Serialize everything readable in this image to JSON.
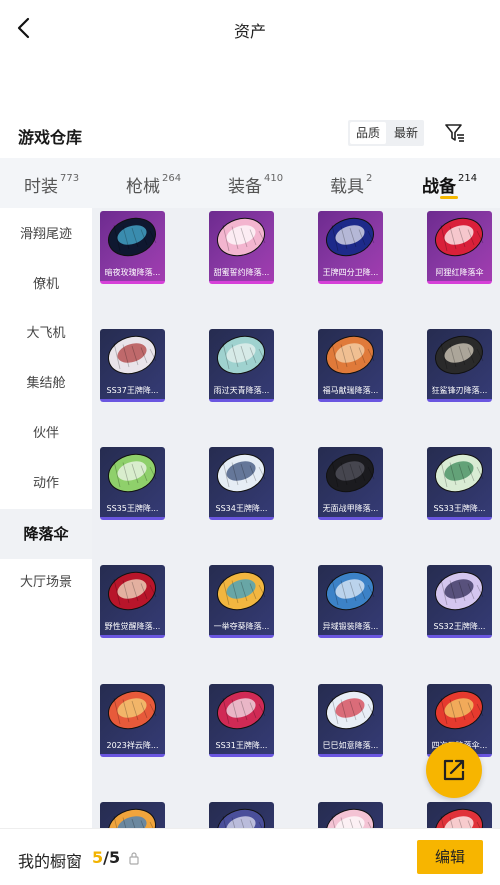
{
  "header": {
    "title": "资产"
  },
  "section": {
    "title": "游戏仓库",
    "sort_options": [
      "品质",
      "最新"
    ]
  },
  "tabs": [
    {
      "label": "时装",
      "count": "773"
    },
    {
      "label": "枪械",
      "count": "264"
    },
    {
      "label": "装备",
      "count": "410"
    },
    {
      "label": "载具",
      "count": "2"
    },
    {
      "label": "战备",
      "count": "214"
    }
  ],
  "sidebar": {
    "items": [
      "滑翔尾迹",
      "僚机",
      "大飞机",
      "集结舱",
      "伙伴",
      "动作",
      "降落伞",
      "大厅场景"
    ]
  },
  "items": [
    {
      "label": "暗夜玫瑰降落...",
      "tier": "purple",
      "colors": [
        "#0f1830",
        "#4ab3d8"
      ]
    },
    {
      "label": "甜蜜誓约降落...",
      "tier": "purple",
      "colors": [
        "#f3b5cf",
        "#ffffff"
      ]
    },
    {
      "label": "王牌四分卫降...",
      "tier": "purple",
      "colors": [
        "#1d2a8a",
        "#e8e8f0"
      ]
    },
    {
      "label": "阿狸红降落伞",
      "tier": "purple",
      "colors": [
        "#d9203a",
        "#ffffff"
      ]
    },
    {
      "label": "SS37王牌降...",
      "tier": "navy",
      "colors": [
        "#e9e4ea",
        "#b04040"
      ]
    },
    {
      "label": "雨过天青降落...",
      "tier": "navy",
      "colors": [
        "#9fd2cf",
        "#e8f2ef"
      ]
    },
    {
      "label": "福马献瑞降落...",
      "tier": "navy",
      "colors": [
        "#e07a3a",
        "#f6d7b0"
      ]
    },
    {
      "label": "狂鲨锋刃降落...",
      "tier": "navy",
      "colors": [
        "#2a2a2a",
        "#d8d0c0"
      ]
    },
    {
      "label": "SS35王牌降...",
      "tier": "navy",
      "colors": [
        "#8fd06b",
        "#f2f7ee"
      ]
    },
    {
      "label": "SS34王牌降...",
      "tier": "navy",
      "colors": [
        "#e6edf5",
        "#3a4f7a"
      ]
    },
    {
      "label": "无面战甲降落...",
      "tier": "navy",
      "colors": [
        "#1b1b1f",
        "#555560"
      ]
    },
    {
      "label": "SS33王牌降...",
      "tier": "navy",
      "colors": [
        "#d9ecd4",
        "#3b8a5a"
      ]
    },
    {
      "label": "野性觉醒降落...",
      "tier": "navy",
      "colors": [
        "#b8152a",
        "#f1e4c8"
      ]
    },
    {
      "label": "一举夺葵降落...",
      "tier": "navy",
      "colors": [
        "#f2b640",
        "#3aa0c8"
      ]
    },
    {
      "label": "异域锻装降落...",
      "tier": "navy",
      "colors": [
        "#3c82c7",
        "#e6eef8"
      ]
    },
    {
      "label": "SS32王牌降...",
      "tier": "navy",
      "colors": [
        "#d4c6ef",
        "#2f2a55"
      ]
    },
    {
      "label": "2023祥云降...",
      "tier": "navy",
      "colors": [
        "#e75a3a",
        "#f6d47a"
      ]
    },
    {
      "label": "SS31王牌降...",
      "tier": "navy",
      "colors": [
        "#d02a55",
        "#f2e6ee"
      ]
    },
    {
      "label": "巳巳如意降落...",
      "tier": "navy",
      "colors": [
        "#e8eef6",
        "#d6404f"
      ]
    },
    {
      "label": "四次元降落伞...",
      "tier": "navy",
      "colors": [
        "#e63a2e",
        "#f4d06a"
      ]
    },
    {
      "label": "",
      "tier": "navy",
      "colors": [
        "#f0a43c",
        "#3f7fc0"
      ]
    },
    {
      "label": "",
      "tier": "navy",
      "colors": [
        "#4a4f9a",
        "#e0e0f0"
      ]
    },
    {
      "label": "",
      "tier": "navy",
      "colors": [
        "#f4c3d4",
        "#ffffff"
      ]
    },
    {
      "label": "",
      "tier": "navy",
      "colors": [
        "#e0323a",
        "#ffffff"
      ]
    }
  ],
  "fab": {
    "icon": "share-external-icon"
  },
  "bottom": {
    "showcase_label": "我的橱窗",
    "current": "5",
    "total": "/5",
    "edit_label": "编辑"
  },
  "colors": {
    "accent": "#f7b500",
    "purple_tier": "#d640d8",
    "navy_tier": "#6a56e0"
  }
}
